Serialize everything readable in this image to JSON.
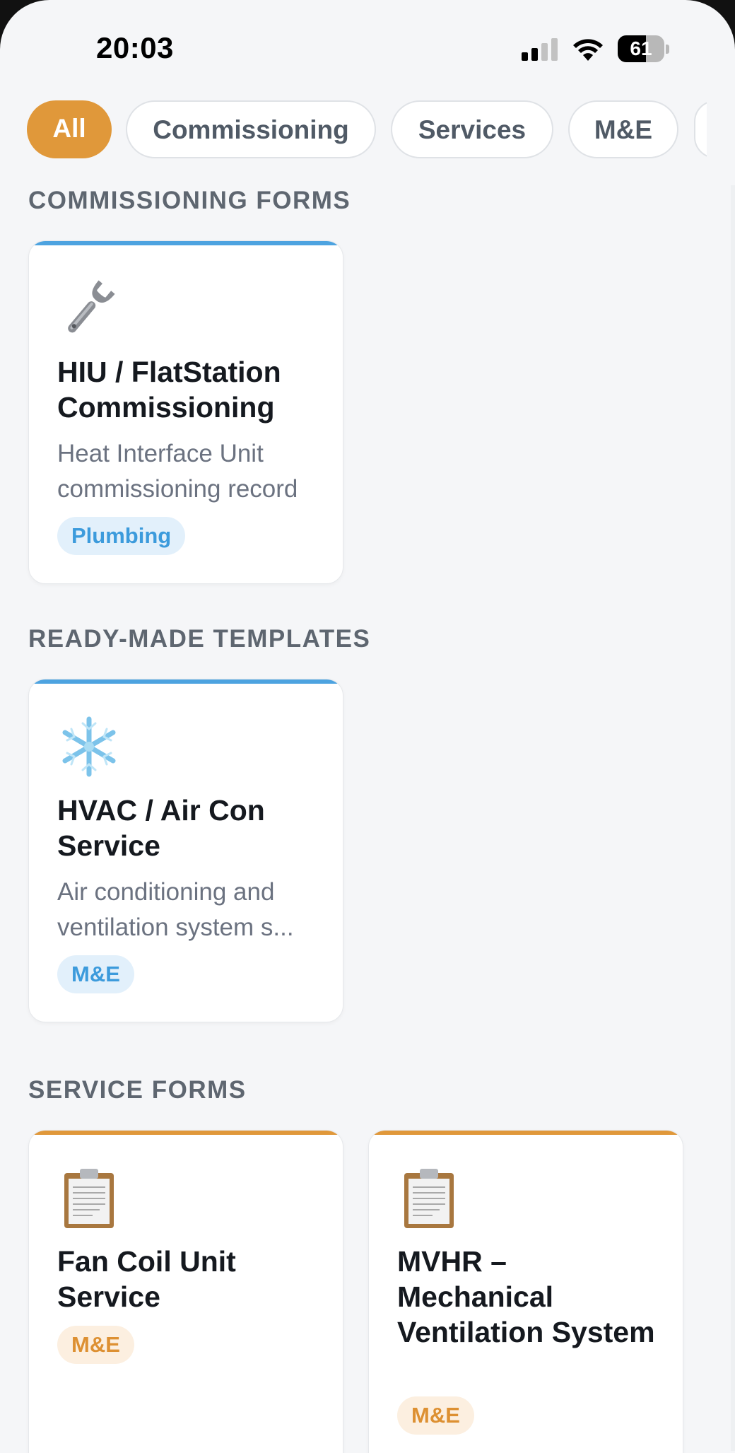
{
  "status_bar": {
    "time": "20:03",
    "battery_level": "61",
    "battery_percent": 61
  },
  "filters": [
    {
      "label": "All",
      "active": true
    },
    {
      "label": "Commissioning",
      "active": false
    },
    {
      "label": "Services",
      "active": false
    },
    {
      "label": "M&E",
      "active": false
    }
  ],
  "sections": [
    {
      "title": "COMMISSIONING FORMS",
      "cards": [
        {
          "icon": "wrench-icon",
          "accent": "#4da3e0",
          "title": "HIU / FlatStation Commissioning",
          "description": "Heat Interface Unit commissioning record",
          "tag": "Plumbing",
          "tag_style": "blue"
        }
      ]
    },
    {
      "title": "READY-MADE TEMPLATES",
      "cards": [
        {
          "icon": "snowflake-icon",
          "accent": "#4da3e0",
          "title": "HVAC / Air Con Service",
          "description": "Air conditioning and ventilation system s...",
          "tag": "M&E",
          "tag_style": "blue"
        }
      ]
    },
    {
      "title": "SERVICE FORMS",
      "cards": [
        {
          "icon": "clipboard-icon",
          "accent": "#e0983a",
          "title": "Fan Coil Unit Service",
          "tag": "M&E",
          "tag_style": "orange"
        },
        {
          "icon": "clipboard-icon",
          "accent": "#e0983a",
          "title": "MVHR – Mechanical Ventilation System",
          "tag": "M&E",
          "tag_style": "orange"
        }
      ]
    }
  ]
}
